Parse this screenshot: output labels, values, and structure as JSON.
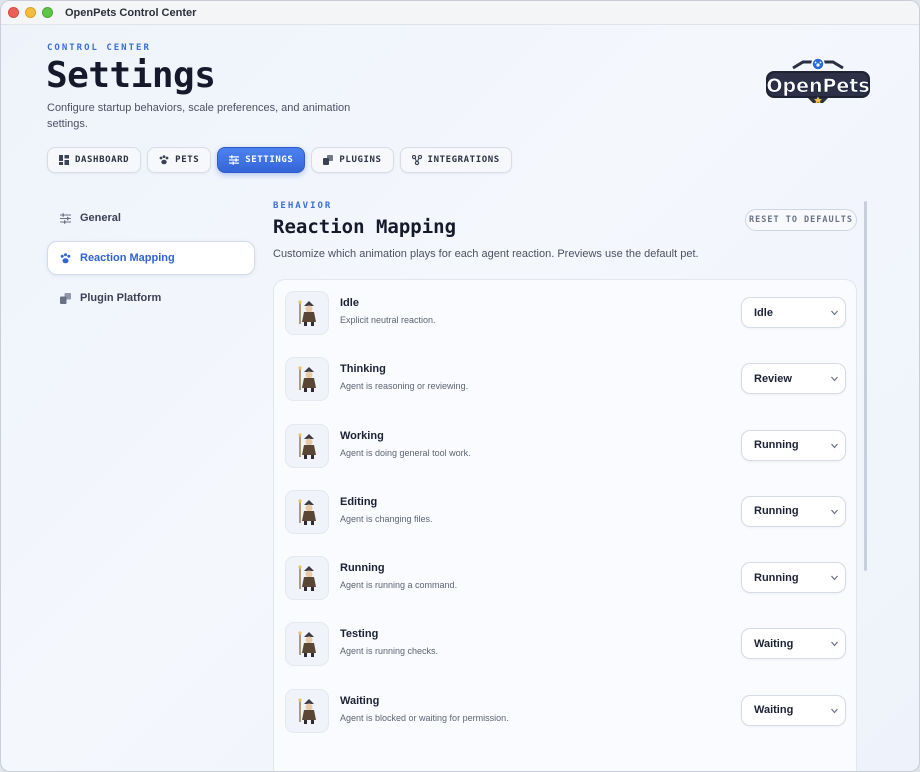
{
  "window": {
    "title": "OpenPets Control Center"
  },
  "header": {
    "eyebrow": "CONTROL CENTER",
    "title": "Settings",
    "subtitle": "Configure startup behaviors, scale preferences, and animation settings.",
    "logo_text": "OpenPets"
  },
  "tabs": [
    {
      "label": "DASHBOARD",
      "icon": "dashboard-icon",
      "active": false
    },
    {
      "label": "PETS",
      "icon": "paw-icon",
      "active": false
    },
    {
      "label": "SETTINGS",
      "icon": "sliders-icon",
      "active": true
    },
    {
      "label": "PLUGINS",
      "icon": "plugin-icon",
      "active": false
    },
    {
      "label": "INTEGRATIONS",
      "icon": "integrations-icon",
      "active": false
    }
  ],
  "sidebar": {
    "items": [
      {
        "label": "General",
        "icon": "sliders-icon",
        "active": false
      },
      {
        "label": "Reaction Mapping",
        "icon": "paw-icon",
        "active": true
      },
      {
        "label": "Plugin Platform",
        "icon": "plugin-icon",
        "active": false
      }
    ]
  },
  "panel": {
    "eyebrow": "BEHAVIOR",
    "title": "Reaction Mapping",
    "subtitle": "Customize which animation plays for each agent reaction. Previews use the default pet.",
    "reset_label": "RESET TO DEFAULTS"
  },
  "reactions": [
    {
      "name": "Idle",
      "desc": "Explicit neutral reaction.",
      "value": "Idle"
    },
    {
      "name": "Thinking",
      "desc": "Agent is reasoning or reviewing.",
      "value": "Review"
    },
    {
      "name": "Working",
      "desc": "Agent is doing general tool work.",
      "value": "Running"
    },
    {
      "name": "Editing",
      "desc": "Agent is changing files.",
      "value": "Running"
    },
    {
      "name": "Running",
      "desc": "Agent is running a command.",
      "value": "Running"
    },
    {
      "name": "Testing",
      "desc": "Agent is running checks.",
      "value": "Waiting"
    },
    {
      "name": "Waiting",
      "desc": "Agent is blocked or waiting for permission.",
      "value": "Waiting"
    }
  ],
  "colors": {
    "accent": "#3565d8",
    "window_bg": "#eef3fb"
  }
}
